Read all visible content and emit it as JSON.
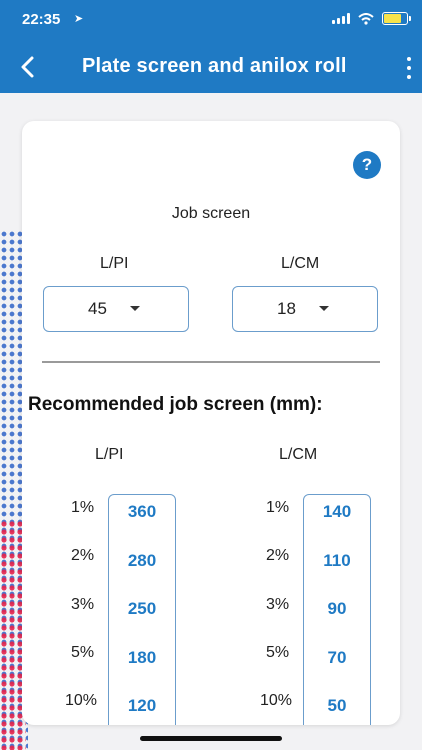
{
  "status_bar": {
    "time": "22:35"
  },
  "header": {
    "title": "Plate screen and anilox roll"
  },
  "help": {
    "label": "?"
  },
  "job_screen": {
    "label": "Job screen",
    "lpi": {
      "label": "L/PI",
      "value": "45"
    },
    "lcm": {
      "label": "L/CM",
      "value": "18"
    }
  },
  "recommended": {
    "title": "Recommended job screen (mm):",
    "lpi_header": "L/PI",
    "lcm_header": "L/CM",
    "rows": [
      {
        "pct": "1%",
        "lpi": "360",
        "lcm": "140"
      },
      {
        "pct": "2%",
        "lpi": "280",
        "lcm": "110"
      },
      {
        "pct": "3%",
        "lpi": "250",
        "lcm": "90"
      },
      {
        "pct": "5%",
        "lpi": "180",
        "lcm": "70"
      },
      {
        "pct": "10%",
        "lpi": "120",
        "lcm": "50"
      }
    ]
  },
  "colors": {
    "accent": "#1f7ac4",
    "border": "#6b9dcc"
  }
}
